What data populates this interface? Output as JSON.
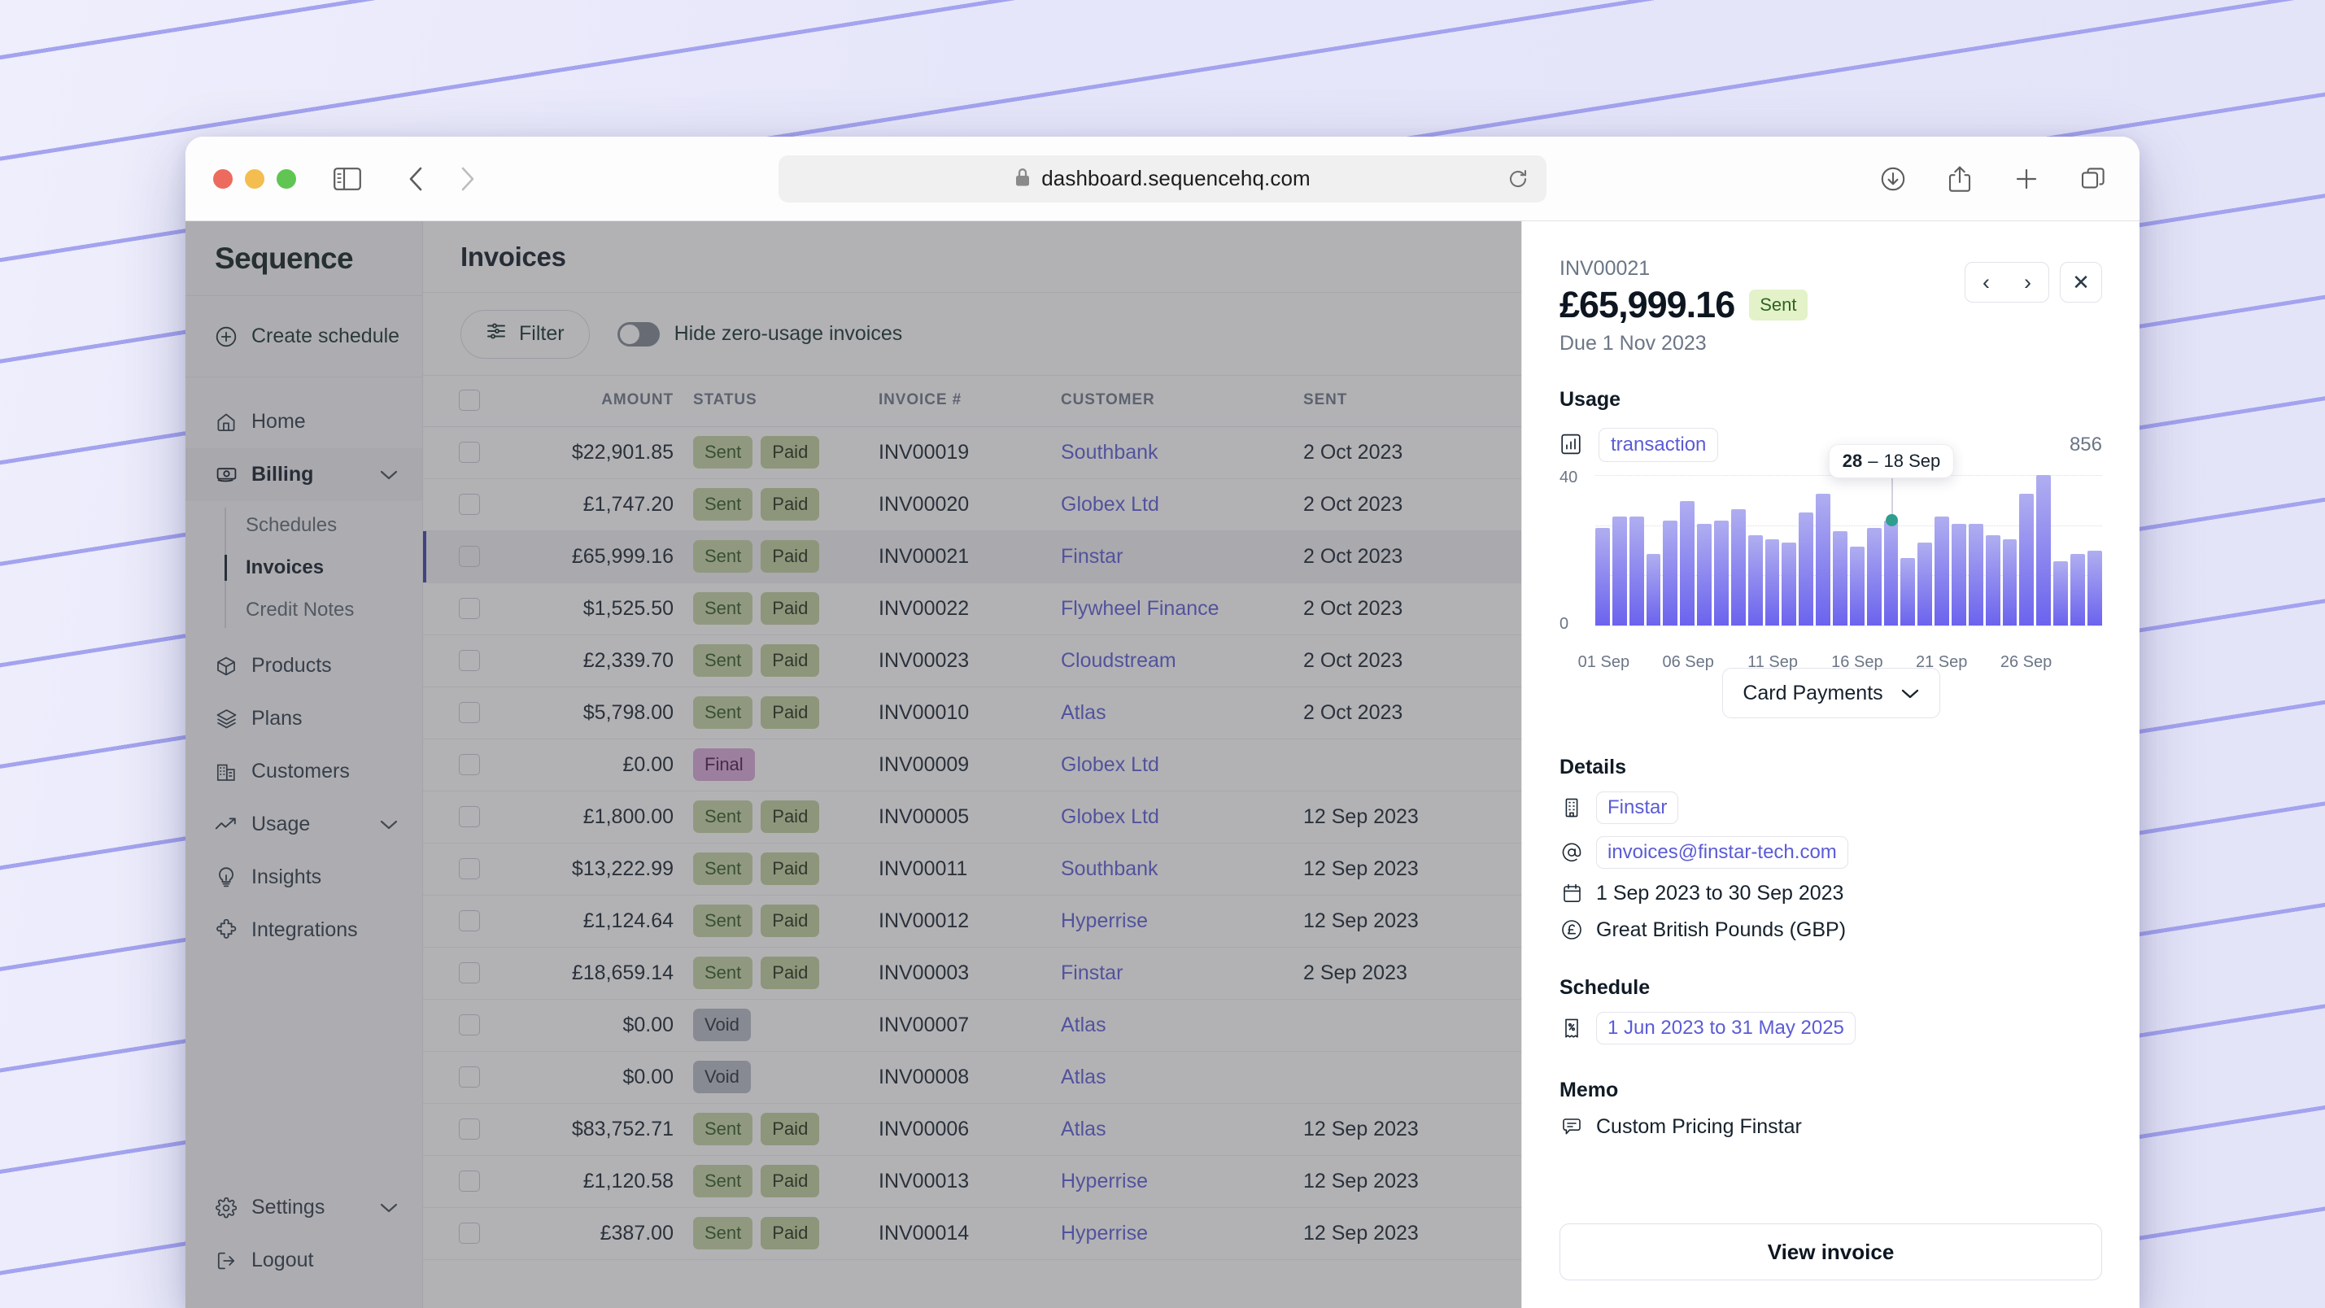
{
  "browser": {
    "url": "dashboard.sequencehq.com",
    "lock_icon": "lock-icon",
    "sidebar_toggle_icon": "sidebar-toggle-icon",
    "back_icon": "chevron-left-icon",
    "forward_icon": "chevron-right-icon",
    "reload_icon": "reload-icon",
    "downloads_icon": "download-icon",
    "share_icon": "share-icon",
    "new_tab_icon": "plus-icon",
    "tabs_icon": "tab-overview-icon"
  },
  "sidebar": {
    "brand": "Sequence",
    "create_schedule": "Create schedule",
    "items": [
      {
        "label": "Home",
        "icon": "home-icon",
        "expandable": false,
        "active": false
      },
      {
        "label": "Billing",
        "icon": "billing-icon",
        "expandable": true,
        "active": true
      },
      {
        "label": "Products",
        "icon": "box-icon",
        "expandable": false,
        "active": false
      },
      {
        "label": "Plans",
        "icon": "layers-icon",
        "expandable": false,
        "active": false
      },
      {
        "label": "Customers",
        "icon": "building-icon",
        "expandable": false,
        "active": false
      },
      {
        "label": "Usage",
        "icon": "trend-up-icon",
        "expandable": true,
        "active": false
      },
      {
        "label": "Insights",
        "icon": "lightbulb-icon",
        "expandable": false,
        "active": false
      },
      {
        "label": "Integrations",
        "icon": "puzzle-icon",
        "expandable": false,
        "active": false
      }
    ],
    "billing_subitems": [
      {
        "label": "Schedules",
        "active": false
      },
      {
        "label": "Invoices",
        "active": true
      },
      {
        "label": "Credit Notes",
        "active": false
      }
    ],
    "bottom_items": [
      {
        "label": "Settings",
        "icon": "gear-icon",
        "expandable": true
      },
      {
        "label": "Logout",
        "icon": "logout-icon",
        "expandable": false
      }
    ]
  },
  "main": {
    "page_title": "Invoices",
    "filter_label": "Filter",
    "filter_icon": "filter-sliders-icon",
    "hide_zero_usage_label": "Hide zero-usage invoices",
    "hide_zero_usage_on": false,
    "table_headers": [
      "",
      "AMOUNT",
      "STATUS",
      "INVOICE #",
      "CUSTOMER",
      "SENT"
    ],
    "rows": [
      {
        "amount": "$22,901.85",
        "badges": [
          "Sent",
          "Paid"
        ],
        "invoice": "INV00019",
        "customer": "Southbank",
        "sent": "2 Oct 2023",
        "selected": false
      },
      {
        "amount": "£1,747.20",
        "badges": [
          "Sent",
          "Paid"
        ],
        "invoice": "INV00020",
        "customer": "Globex Ltd",
        "sent": "2 Oct 2023",
        "selected": false
      },
      {
        "amount": "£65,999.16",
        "badges": [
          "Sent",
          "Paid"
        ],
        "invoice": "INV00021",
        "customer": "Finstar",
        "sent": "2 Oct 2023",
        "selected": true
      },
      {
        "amount": "$1,525.50",
        "badges": [
          "Sent",
          "Paid"
        ],
        "invoice": "INV00022",
        "customer": "Flywheel Finance",
        "sent": "2 Oct 2023",
        "selected": false
      },
      {
        "amount": "£2,339.70",
        "badges": [
          "Sent",
          "Paid"
        ],
        "invoice": "INV00023",
        "customer": "Cloudstream",
        "sent": "2 Oct 2023",
        "selected": false
      },
      {
        "amount": "$5,798.00",
        "badges": [
          "Sent",
          "Paid"
        ],
        "invoice": "INV00010",
        "customer": "Atlas",
        "sent": "2 Oct 2023",
        "selected": false
      },
      {
        "amount": "£0.00",
        "badges": [
          "Final"
        ],
        "invoice": "INV00009",
        "customer": "Globex Ltd",
        "sent": "",
        "selected": false
      },
      {
        "amount": "£1,800.00",
        "badges": [
          "Sent",
          "Paid"
        ],
        "invoice": "INV00005",
        "customer": "Globex Ltd",
        "sent": "12 Sep 2023",
        "selected": false
      },
      {
        "amount": "$13,222.99",
        "badges": [
          "Sent",
          "Paid"
        ],
        "invoice": "INV00011",
        "customer": "Southbank",
        "sent": "12 Sep 2023",
        "selected": false
      },
      {
        "amount": "£1,124.64",
        "badges": [
          "Sent",
          "Paid"
        ],
        "invoice": "INV00012",
        "customer": "Hyperrise",
        "sent": "12 Sep 2023",
        "selected": false
      },
      {
        "amount": "£18,659.14",
        "badges": [
          "Sent",
          "Paid"
        ],
        "invoice": "INV00003",
        "customer": "Finstar",
        "sent": "2 Sep 2023",
        "selected": false
      },
      {
        "amount": "$0.00",
        "badges": [
          "Void"
        ],
        "invoice": "INV00007",
        "customer": "Atlas",
        "sent": "",
        "selected": false
      },
      {
        "amount": "$0.00",
        "badges": [
          "Void"
        ],
        "invoice": "INV00008",
        "customer": "Atlas",
        "sent": "",
        "selected": false
      },
      {
        "amount": "$83,752.71",
        "badges": [
          "Sent",
          "Paid"
        ],
        "invoice": "INV00006",
        "customer": "Atlas",
        "sent": "12 Sep 2023",
        "selected": false
      },
      {
        "amount": "£1,120.58",
        "badges": [
          "Sent",
          "Paid"
        ],
        "invoice": "INV00013",
        "customer": "Hyperrise",
        "sent": "12 Sep 2023",
        "selected": false
      },
      {
        "amount": "£387.00",
        "badges": [
          "Sent",
          "Paid"
        ],
        "invoice": "INV00014",
        "customer": "Hyperrise",
        "sent": "12 Sep 2023",
        "selected": false
      }
    ]
  },
  "detail_panel": {
    "invoice_number": "INV00021",
    "amount": "£65,999.16",
    "status": "Sent",
    "due": "Due 1 Nov 2023",
    "prev_icon": "chevron-left-icon",
    "next_icon": "chevron-right-icon",
    "close_icon": "close-icon",
    "usage_title": "Usage",
    "usage_metric": "transaction",
    "usage_metric_icon": "bar-chart-icon",
    "usage_total": "856",
    "payment_method": "Card Payments",
    "payment_chevron_icon": "chevron-down-icon",
    "details_title": "Details",
    "details": [
      {
        "icon": "building-icon",
        "value": "Finstar",
        "pill": true
      },
      {
        "icon": "at-email-icon",
        "value": "invoices@finstar-tech.com",
        "pill": true
      },
      {
        "icon": "calendar-icon",
        "value": "1 Sep 2023 to 30 Sep 2023",
        "pill": false
      },
      {
        "icon": "pound-currency-icon",
        "value": "Great British Pounds (GBP)",
        "pill": false
      }
    ],
    "schedule_title": "Schedule",
    "schedule_icon": "receipt-percent-icon",
    "schedule_value": "1 Jun 2023 to 31 May 2025",
    "memo_title": "Memo",
    "memo_icon": "comment-icon",
    "memo_value": "Custom Pricing Finstar",
    "view_invoice_label": "View invoice"
  },
  "chart_data": {
    "type": "bar",
    "title": "Usage",
    "ylabel": "",
    "xlabel": "",
    "ylim": [
      0,
      40
    ],
    "ytick_labels": [
      "0",
      "40"
    ],
    "grid": true,
    "series_name": "transaction",
    "total": 856,
    "categories": [
      "01 Sep",
      "02 Sep",
      "03 Sep",
      "04 Sep",
      "05 Sep",
      "06 Sep",
      "07 Sep",
      "08 Sep",
      "09 Sep",
      "10 Sep",
      "11 Sep",
      "12 Sep",
      "13 Sep",
      "14 Sep",
      "15 Sep",
      "16 Sep",
      "17 Sep",
      "18 Sep",
      "19 Sep",
      "20 Sep",
      "21 Sep",
      "22 Sep",
      "23 Sep",
      "24 Sep",
      "25 Sep",
      "26 Sep",
      "27 Sep",
      "28 Sep",
      "29 Sep",
      "30 Sep"
    ],
    "values": [
      26,
      29,
      29,
      19,
      28,
      33,
      27,
      28,
      31,
      24,
      23,
      22,
      30,
      35,
      25,
      21,
      26,
      28,
      18,
      22,
      29,
      27,
      27,
      24,
      23,
      35,
      40,
      17,
      19,
      20
    ],
    "xtick_labels": [
      "01 Sep",
      "06 Sep",
      "11 Sep",
      "16 Sep",
      "21 Sep",
      "26 Sep"
    ],
    "xtick_indices": [
      0,
      5,
      10,
      15,
      20,
      25
    ],
    "tooltip": {
      "value": "28",
      "separator": "–",
      "label": "18 Sep",
      "index": 17
    },
    "bar_color_top": "#b0aef0",
    "bar_color_bottom": "#6b63ee",
    "highlight_dot_color": "#2f9e8f"
  }
}
